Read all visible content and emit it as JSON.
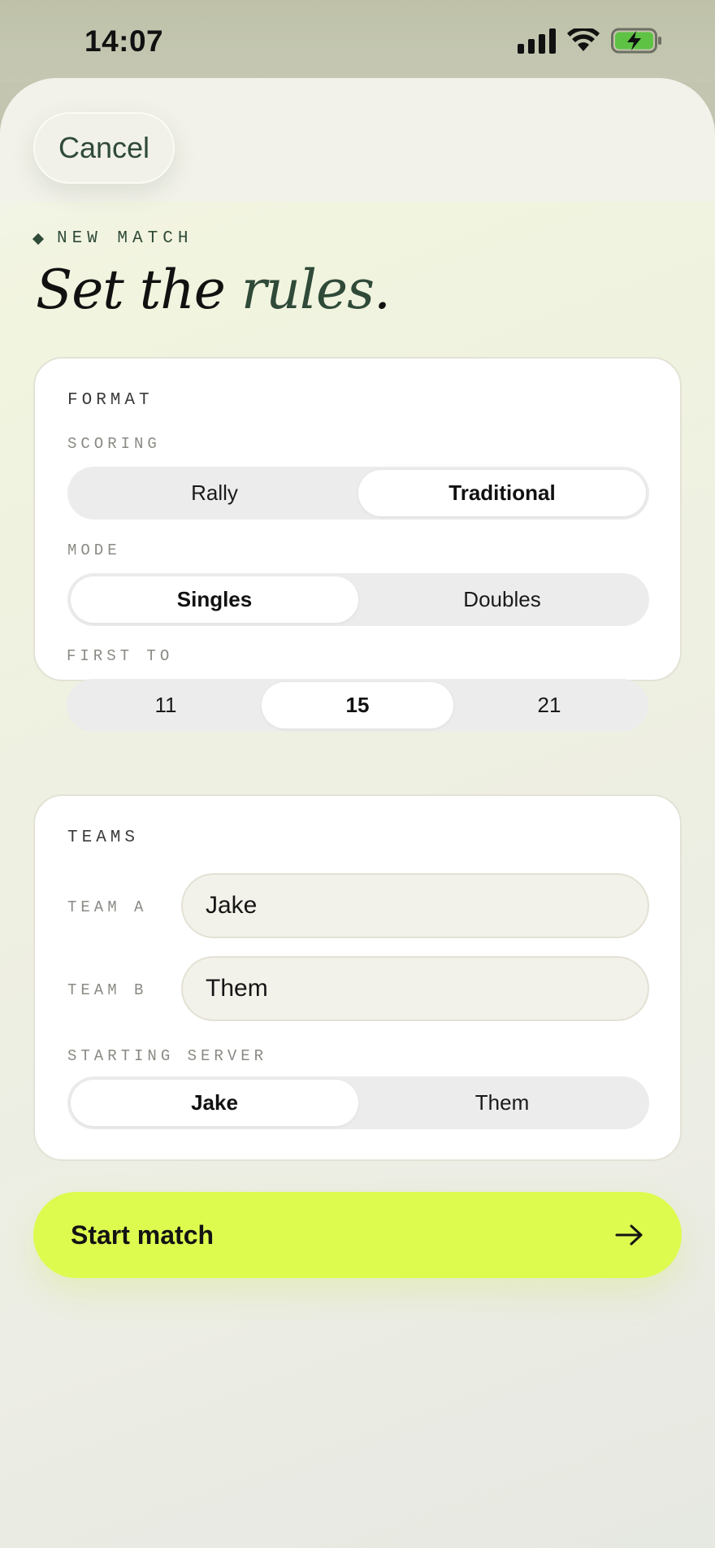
{
  "status_bar": {
    "time": "14:07",
    "icons": [
      "signal-icon",
      "wifi-icon",
      "battery-charging-icon"
    ],
    "battery_color": "#5ec244"
  },
  "header": {
    "cancel_label": "Cancel"
  },
  "intro": {
    "eyebrow": "NEW MATCH",
    "headline_start": "Set the ",
    "headline_accent": "rules",
    "headline_end": "."
  },
  "format": {
    "title": "FORMAT",
    "scoring": {
      "label": "SCORING",
      "options": [
        "Rally",
        "Traditional"
      ],
      "selected": "Traditional"
    },
    "mode": {
      "label": "MODE",
      "options": [
        "Singles",
        "Doubles"
      ],
      "selected": "Singles"
    },
    "first_to": {
      "label": "FIRST TO",
      "options": [
        "11",
        "15",
        "21"
      ],
      "selected": "15"
    }
  },
  "teams": {
    "title": "TEAMS",
    "team_a": {
      "label": "TEAM A",
      "value": "Jake"
    },
    "team_b": {
      "label": "TEAM B",
      "value": "Them"
    },
    "starting_server": {
      "label": "STARTING SERVER",
      "options": [
        "Jake",
        "Them"
      ],
      "selected": "Jake"
    }
  },
  "actions": {
    "start_label": "Start match"
  },
  "colors": {
    "accent_green": "#2f4a38",
    "start_button": "#ddfb4f"
  }
}
